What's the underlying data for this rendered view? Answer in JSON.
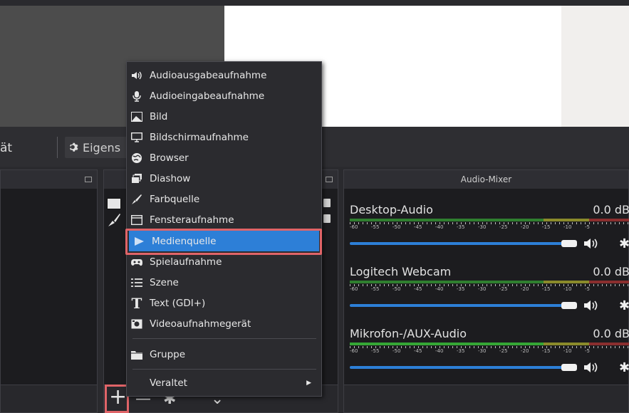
{
  "toolbar": {
    "left_text": "ät",
    "properties_label": "Eigens"
  },
  "mixer": {
    "title": "Audio-Mixer",
    "tick_labels": [
      "-60",
      "-55",
      "-50",
      "-45",
      "-40",
      "-35",
      "-30",
      "-25",
      "-20",
      "-15",
      "-10",
      "-5"
    ],
    "channels": [
      {
        "name": "Desktop-Audio",
        "db": "0.0 dB",
        "volume": 1.0
      },
      {
        "name": "Logitech Webcam",
        "db": "0.0 dB",
        "volume": 1.0
      },
      {
        "name": "Mikrofon-/AUX-Audio",
        "db": "0.0 dB",
        "volume": 1.0
      }
    ]
  },
  "context_menu": {
    "items": [
      {
        "label": "Audioausgabeaufnahme",
        "icon": "speaker-icon"
      },
      {
        "label": "Audioeingabeaufnahme",
        "icon": "microphone-icon"
      },
      {
        "label": "Bild",
        "icon": "image-icon"
      },
      {
        "label": "Bildschirmaufnahme",
        "icon": "monitor-icon"
      },
      {
        "label": "Browser",
        "icon": "globe-icon"
      },
      {
        "label": "Diashow",
        "icon": "slideshow-icon"
      },
      {
        "label": "Farbquelle",
        "icon": "brush-icon"
      },
      {
        "label": "Fensteraufnahme",
        "icon": "window-icon"
      },
      {
        "label": "Medienquelle",
        "icon": "play-icon",
        "selected": true
      },
      {
        "label": "Spielaufnahme",
        "icon": "gamepad-icon"
      },
      {
        "label": "Szene",
        "icon": "list-icon"
      },
      {
        "label": "Text (GDI+)",
        "icon": "text-icon"
      },
      {
        "label": "Videoaufnahmegerät",
        "icon": "camera-icon"
      }
    ],
    "group_label": "Gruppe",
    "legacy_label": "Veraltet"
  },
  "sources_footer": {
    "add_label": "+"
  },
  "colors": {
    "accent": "#2d7fd7",
    "highlight_box": "#e06468"
  }
}
